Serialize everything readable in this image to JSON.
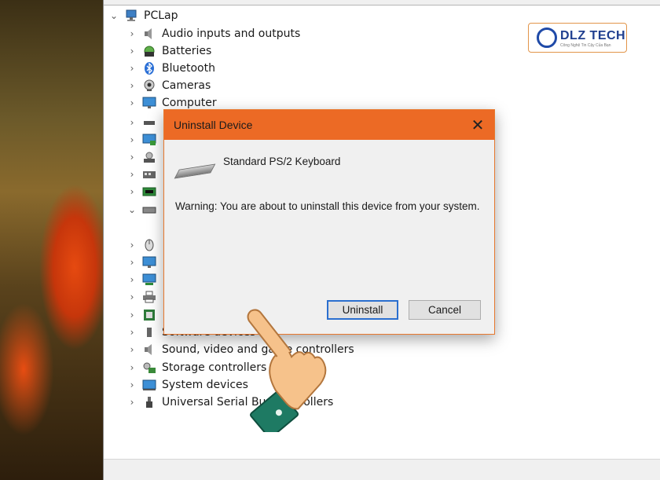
{
  "tree": {
    "root": "PCLap",
    "items": [
      {
        "label": "Audio inputs and outputs",
        "icon": "speaker-icon"
      },
      {
        "label": "Batteries",
        "icon": "battery-icon"
      },
      {
        "label": "Bluetooth",
        "icon": "bluetooth-icon"
      },
      {
        "label": "Cameras",
        "icon": "camera-icon"
      },
      {
        "label": "Computer",
        "icon": "monitor-icon"
      },
      {
        "label": "",
        "icon": "disk-drive-icon"
      },
      {
        "label": "",
        "icon": "display-adapter-icon"
      },
      {
        "label": "",
        "icon": "dvd-drive-icon"
      },
      {
        "label": "",
        "icon": "hid-icon"
      },
      {
        "label": "",
        "icon": "ide-controller-icon"
      },
      {
        "label": "",
        "icon": "keyboard-icon"
      },
      {
        "label": "",
        "icon": "mouse-icon"
      },
      {
        "label": "",
        "icon": "monitor-icon"
      },
      {
        "label": "",
        "icon": "network-icon"
      },
      {
        "label": "",
        "icon": "print-queue-icon"
      },
      {
        "label": "",
        "icon": "processor-icon"
      },
      {
        "label": "Software devices",
        "icon": "software-icon"
      },
      {
        "label": "Sound, video and game controllers",
        "icon": "sound-icon"
      },
      {
        "label": "Storage controllers",
        "icon": "storage-icon"
      },
      {
        "label": "System devices",
        "icon": "system-icon"
      },
      {
        "label": "Universal Serial Bus controllers",
        "icon": "usb-icon"
      }
    ]
  },
  "logo": {
    "name": "DLZ TECH",
    "tagline": "Công Nghệ Tin Cậy Của Bạn"
  },
  "dialog": {
    "title": "Uninstall Device",
    "close_glyph": "✕",
    "device_name": "Standard PS/2 Keyboard",
    "warning": "Warning: You are about to uninstall this device from your system.",
    "uninstall_label": "Uninstall",
    "cancel_label": "Cancel"
  },
  "colors": {
    "dialog_title_bar": "#ec6a25",
    "primary_button_border": "#2b6fcf",
    "hand_sleeve": "#1e7a63",
    "hand_skin": "#f6c28b"
  }
}
